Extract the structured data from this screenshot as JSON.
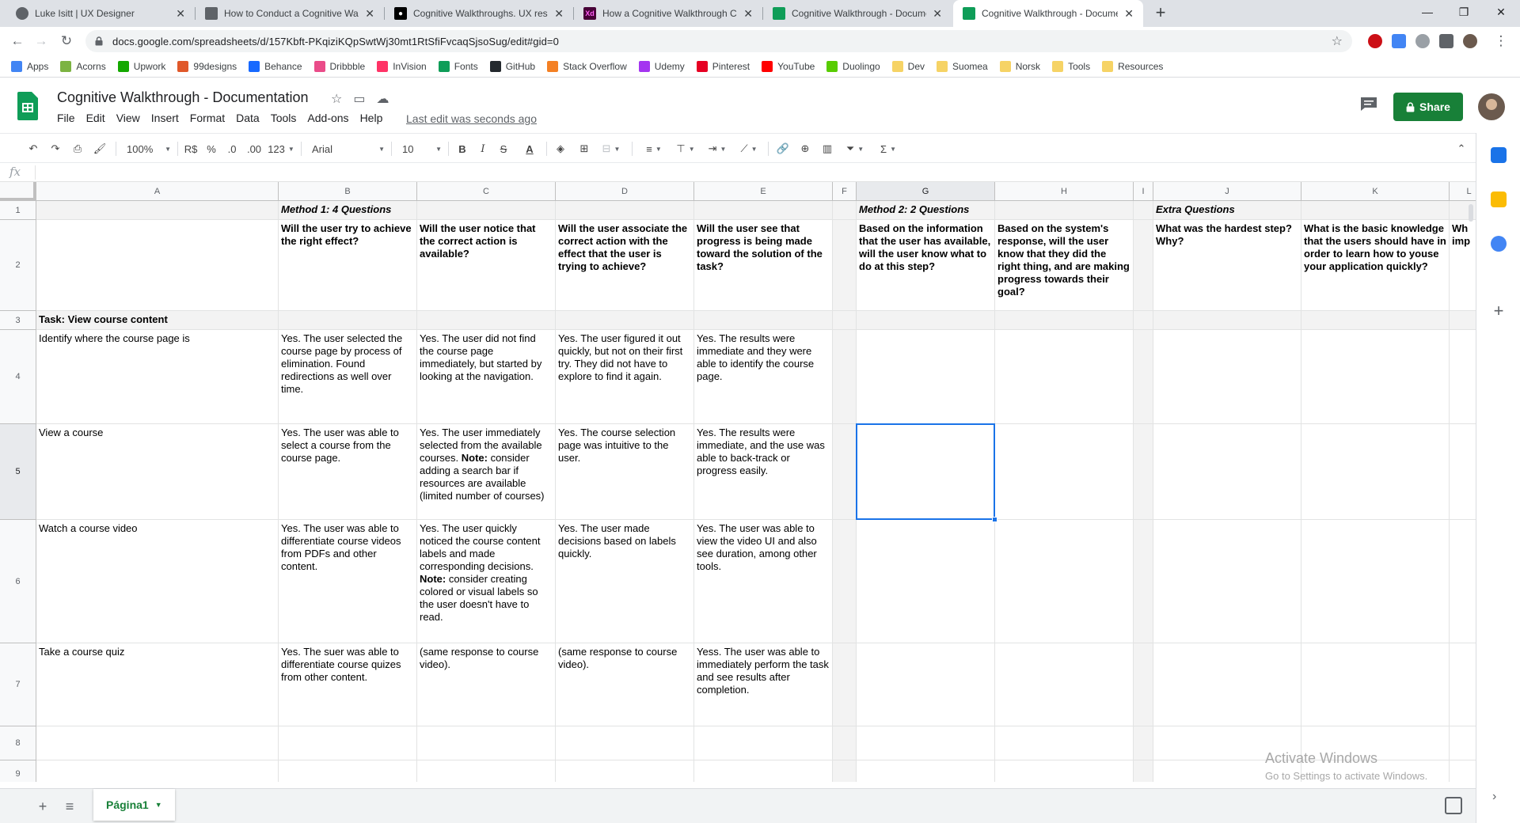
{
  "browser": {
    "tabs": [
      {
        "title": "Luke Isitt | UX Designer",
        "favicon": "globe-icon",
        "color": "#5f6368"
      },
      {
        "title": "How to Conduct a Cognitive Wal",
        "favicon": "tree-icon",
        "color": "#5f6368"
      },
      {
        "title": "Cognitive Walkthroughs. UX rese",
        "favicon": "medium-icon",
        "color": "#000000"
      },
      {
        "title": "How a Cognitive Walkthrough Ca",
        "favicon": "xd-icon",
        "color": "#470137"
      },
      {
        "title": "Cognitive Walkthrough - Docume",
        "favicon": "sheets-icon",
        "color": "#0f9d58"
      },
      {
        "title": "Cognitive Walkthrough - Docume",
        "favicon": "sheets-icon",
        "color": "#0f9d58"
      }
    ],
    "url": "docs.google.com/spreadsheets/d/157Kbft-PKqiziKQpSwtWj30mt1RtSfiFvcaqSjsoSug/edit#gid=0",
    "bookmarks": [
      {
        "label": "Apps",
        "color": "#4285f4"
      },
      {
        "label": "Acorns",
        "color": "#7cb342"
      },
      {
        "label": "Upwork",
        "color": "#14a800"
      },
      {
        "label": "99designs",
        "color": "#e0582a"
      },
      {
        "label": "Behance",
        "color": "#1769ff"
      },
      {
        "label": "Dribbble",
        "color": "#ea4c89"
      },
      {
        "label": "InVision",
        "color": "#ff3366"
      },
      {
        "label": "Fonts",
        "color": "#0f9d58"
      },
      {
        "label": "GitHub",
        "color": "#24292e"
      },
      {
        "label": "Stack Overflow",
        "color": "#f48024"
      },
      {
        "label": "Udemy",
        "color": "#a435f0"
      },
      {
        "label": "Pinterest",
        "color": "#e60023"
      },
      {
        "label": "YouTube",
        "color": "#ff0000"
      },
      {
        "label": "Duolingo",
        "color": "#58cc02"
      },
      {
        "label": "Dev",
        "color": "#f6d365"
      },
      {
        "label": "Suomea",
        "color": "#f6d365"
      },
      {
        "label": "Norsk",
        "color": "#f6d365"
      },
      {
        "label": "Tools",
        "color": "#f6d365"
      },
      {
        "label": "Resources",
        "color": "#f6d365"
      }
    ]
  },
  "doc": {
    "title": "Cognitive Walkthrough - Documentation",
    "menu": [
      "File",
      "Edit",
      "View",
      "Insert",
      "Format",
      "Data",
      "Tools",
      "Add-ons",
      "Help"
    ],
    "last_edit": "Last edit was seconds ago",
    "share_label": "Share"
  },
  "toolbar": {
    "zoom": "100%",
    "currency": "R$",
    "percent": "%",
    "dec_decrease": ".0",
    "dec_increase": ".00",
    "more_formats": "123",
    "font": "Arial",
    "font_size": "10"
  },
  "formula_bar": {
    "fx": "fx",
    "value": ""
  },
  "sheet": {
    "columns": [
      "A",
      "B",
      "C",
      "D",
      "E",
      "F",
      "G",
      "H",
      "I",
      "J",
      "K",
      "L"
    ],
    "rows": [
      "1",
      "2",
      "3",
      "4",
      "5",
      "6",
      "7",
      "8",
      "9"
    ],
    "cells": {
      "B1": "Method 1: 4 Questions",
      "G1": "Method 2: 2 Questions",
      "J1": "Extra Questions",
      "B2": "Will the user try to achieve the right effect?",
      "C2": "Will the user notice that the correct action is available?",
      "D2": "Will the user associate the correct action with the effect that the user is trying to achieve?",
      "E2": "Will the user see that progress is being made toward the solution of the task?",
      "G2": "Based on the information that the user has available, will the user know what to do at this step?",
      "H2": "Based on the system's response, will the user know that they did the right thing, and are making progress towards their goal?",
      "J2": "What was the hardest step? Why?",
      "K2": "What is the basic knowledge that the users should have in order to learn how to youse your application quickly?",
      "L2": "Wh imp",
      "A3": "Task: View course content",
      "A4": "Identify where the course page is",
      "B4": "Yes. The user selected the course page by process of elimination. Found redirections as well over time.",
      "C4": "Yes. The user did not find the course page immediately, but started by looking at the navigation.",
      "D4": "Yes. The user figured it out quickly, but not on their first try. They did not have to explore to find it again.",
      "E4": "Yes. The results were immediate and they were able to identify the course page.",
      "A5": "View a course",
      "B5": "Yes. The user was able to select a course from the course page.",
      "C5_pre": "Yes. The user immediately selected from the available courses. ",
      "C5_note": "Note:",
      "C5_post": " consider adding a search bar if resources are available (limited number of courses)",
      "D5": "Yes. The course selection page was intuitive to the user.",
      "E5": "Yes. The results were immediate, and the use was able to back-track or progress easily.",
      "A6": "Watch a course video",
      "B6": "Yes. The user was able to differentiate course videos from PDFs and other content.",
      "C6_pre": "Yes. The user quickly noticed the course content labels and made corresponding decisions. ",
      "C6_note": "Note:",
      "C6_post": " consider creating colored or visual labels so the user doesn't have to read.",
      "D6": "Yes. The user made decisions based on labels quickly.",
      "E6": "Yes. The user was able to view the video UI and also see duration, among other tools.",
      "A7": "Take a course quiz",
      "B7": "Yes. The suer was able to differentiate course quizes from other content.",
      "C7": "(same response to course video).",
      "D7": "(same response to course video).",
      "E7": "Yess. The user was able to immediately perform the task and see results after completion."
    }
  },
  "watermark": {
    "line1": "Activate Windows",
    "line2": "Go to Settings to activate Windows."
  },
  "sheet_tab": "Página1"
}
